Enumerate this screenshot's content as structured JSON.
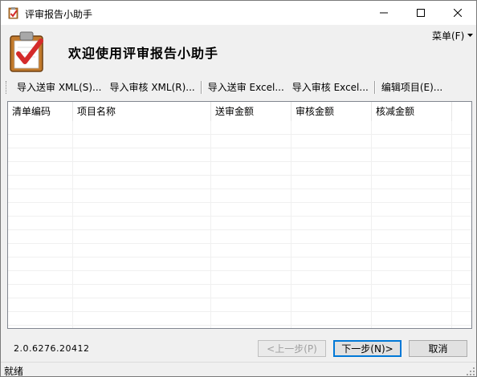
{
  "window": {
    "title": "评审报告小助手",
    "icon": "clipboard-check-icon"
  },
  "header": {
    "welcome": "欢迎使用评审报告小助手",
    "menu_label": "菜单(F)"
  },
  "toolbar": {
    "items": [
      "导入送审 XML(S)...",
      "导入审核 XML(R)...",
      "导入送审 Excel...",
      "导入审核 Excel...",
      "编辑项目(E)..."
    ]
  },
  "grid": {
    "columns": [
      "清单编码",
      "项目名称",
      "送审金额",
      "审核金额",
      "核减金额"
    ],
    "rows": []
  },
  "footer": {
    "version": "2.0.6276.20412",
    "prev_label": "<上一步(P)",
    "next_label": "下一步(N)>",
    "cancel_label": "取消"
  },
  "status": {
    "text": "就绪"
  },
  "colors": {
    "accent": "#0078d7",
    "logo_check": "#d42b2b",
    "logo_board": "#c27a2c"
  }
}
